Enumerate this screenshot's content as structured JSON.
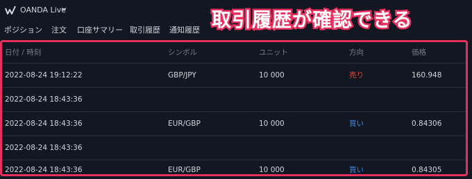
{
  "header": {
    "broker_label": "OANDA Live",
    "icons": {
      "logo": "oanda-logo-icon",
      "chevron": "chevron-down-icon"
    }
  },
  "tabs": [
    {
      "label": "ポジション"
    },
    {
      "label": "注文"
    },
    {
      "label": "口座サマリー"
    },
    {
      "label": "取引履歴"
    },
    {
      "label": "通知履歴"
    }
  ],
  "annotation": {
    "text": "取引履歴が確認できる",
    "color": "#e8305f"
  },
  "table": {
    "columns": [
      "日付 / 時刻",
      "シンボル",
      "ユニット",
      "方向",
      "価格"
    ],
    "rows": [
      {
        "time": "2022-08-24 19:12:22",
        "symbol": "GBP/JPY",
        "units": "10 000",
        "side": "売り",
        "price": "160.948"
      },
      {
        "time": "2022-08-24 18:43:36",
        "symbol": "",
        "units": "",
        "side": "",
        "price": ""
      },
      {
        "time": "2022-08-24 18:43:36",
        "symbol": "EUR/GBP",
        "units": "10 000",
        "side": "買い",
        "price": "0.84306"
      },
      {
        "time": "2022-08-24 18:43:36",
        "symbol": "",
        "units": "",
        "side": "",
        "price": ""
      },
      {
        "time": "2022-08-24 18:43:36",
        "symbol": "EUR/GBP",
        "units": "10 000",
        "side": "買い",
        "price": "0.84305"
      }
    ]
  },
  "colors": {
    "background": "#131722",
    "text": "#d1d4dc",
    "muted": "#787b86",
    "sell": "#e0493c",
    "buy": "#3b8aef"
  }
}
